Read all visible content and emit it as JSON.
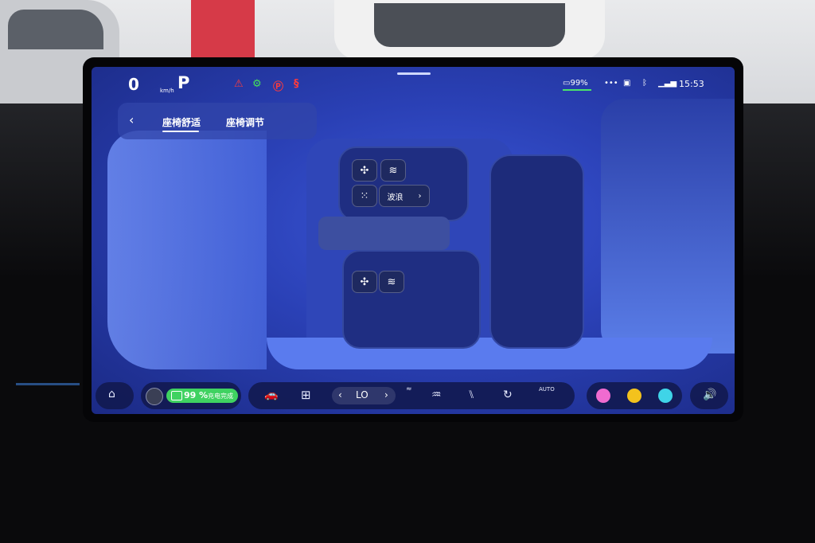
{
  "status_bar": {
    "speed": "0",
    "speed_unit": "km/h",
    "gear": "P",
    "battery_percent": "99%",
    "time": "15:53"
  },
  "seat_panel": {
    "tabs": [
      "座椅舒适",
      "座椅调节"
    ],
    "active_tab": 0,
    "massage_mode": "波浪"
  },
  "dock": {
    "battery_percent": "99 %",
    "charge_status": "充电完成",
    "climate_temp": "LO",
    "auto_label": "AUTO"
  },
  "colors": {
    "battery_green": "#3fd261",
    "warning_red": "#ff3b3b",
    "indicator_green": "#45e25a",
    "app_pink": "#f06bd0",
    "app_yellow": "#f3c21d",
    "app_cyan": "#3fd4e8"
  },
  "icons": [
    "seatbelt-warning-icon",
    "headlight-icon",
    "parking-brake-icon",
    "esc-off-icon",
    "home-icon",
    "car-icon",
    "apps-grid-icon",
    "defrost-front-icon",
    "defrost-rear-icon",
    "seat-heat-icon",
    "recirculation-icon",
    "auto-climate-icon",
    "volume-icon",
    "fan-icon",
    "heat-icon",
    "massage-icon"
  ]
}
